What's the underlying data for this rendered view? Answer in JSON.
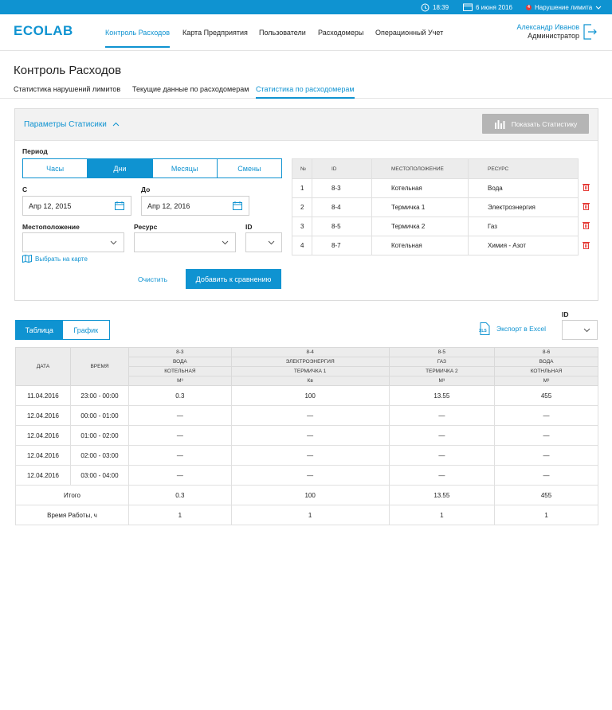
{
  "topbar": {
    "time": "18:39",
    "date": "6 июня 2016",
    "alert_count": "4",
    "alert_label": "Нарушение лимита"
  },
  "header": {
    "logo": "ECOLAB",
    "nav": [
      "Контроль Расходов",
      "Карта Предприятия",
      "Пользователи",
      "Расходомеры",
      "Операционный Учет"
    ],
    "user_name": "Александр Иванов",
    "user_role": "Администратор"
  },
  "page": {
    "title": "Контроль Расходов",
    "subtabs": [
      "Статистика нарушений лимитов",
      "Текущие данные по расходомерам",
      "Статистика по расходомерам"
    ]
  },
  "params": {
    "title": "Параметры Статисики",
    "show_button": "Показать Статистику",
    "period_label": "Период",
    "periods": [
      "Часы",
      "Дни",
      "Месяцы",
      "Смены"
    ],
    "from_label": "С",
    "from_value": "Апр 12, 2015",
    "to_label": "До",
    "to_value": "Апр 12, 2016",
    "location_label": "Местоположение",
    "resource_label": "Ресурс",
    "id_label": "ID",
    "map_link": "Выбрать на карте",
    "clear": "Очистить",
    "add_compare": "Добавить к сравнению",
    "table_headers": [
      "№",
      "ID",
      "Местоположение",
      "Ресурс"
    ],
    "rows": [
      [
        "1",
        "8-3",
        "Котельная",
        "Вода"
      ],
      [
        "2",
        "8-4",
        "Термичка 1",
        "Электроэнергия"
      ],
      [
        "3",
        "8-5",
        "Термичка 2",
        "Газ"
      ],
      [
        "4",
        "8-7",
        "Котельная",
        "Химия - Азот"
      ]
    ]
  },
  "results": {
    "toggle": [
      "Таблица",
      "График"
    ],
    "id_label": "ID",
    "export": "Экспорт в Excel",
    "xls": "XLS",
    "col_date": "Дата",
    "col_time": "Время",
    "meters": [
      {
        "id": "8-3",
        "resource": "Вода",
        "location": "Котельная",
        "unit": "М³"
      },
      {
        "id": "8-4",
        "resource": "Электроэнергия",
        "location": "Термичка 1",
        "unit": "Кв"
      },
      {
        "id": "8-5",
        "resource": "Газ",
        "location": "Термичка 2",
        "unit": "М³"
      },
      {
        "id": "8-6",
        "resource": "Вода",
        "location": "Котнльная",
        "unit": "М³"
      }
    ],
    "rows": [
      [
        "11.04.2016",
        "23:00 - 00:00",
        "0.3",
        "100",
        "13.55",
        "455"
      ],
      [
        "12.04.2016",
        "00:00 - 01:00",
        "—",
        "—",
        "—",
        "—"
      ],
      [
        "12.04.2016",
        "01:00 - 02:00",
        "—",
        "—",
        "—",
        "—"
      ],
      [
        "12.04.2016",
        "02:00 - 03:00",
        "—",
        "—",
        "—",
        "—"
      ],
      [
        "12.04.2016",
        "03:00 - 04:00",
        "—",
        "—",
        "—",
        "—"
      ]
    ],
    "total_label": "Итого",
    "totals": [
      "0.3",
      "100",
      "13.55",
      "455"
    ],
    "worktime_label": "Время Работы, ч",
    "worktime": [
      "1",
      "1",
      "1",
      "1"
    ]
  }
}
